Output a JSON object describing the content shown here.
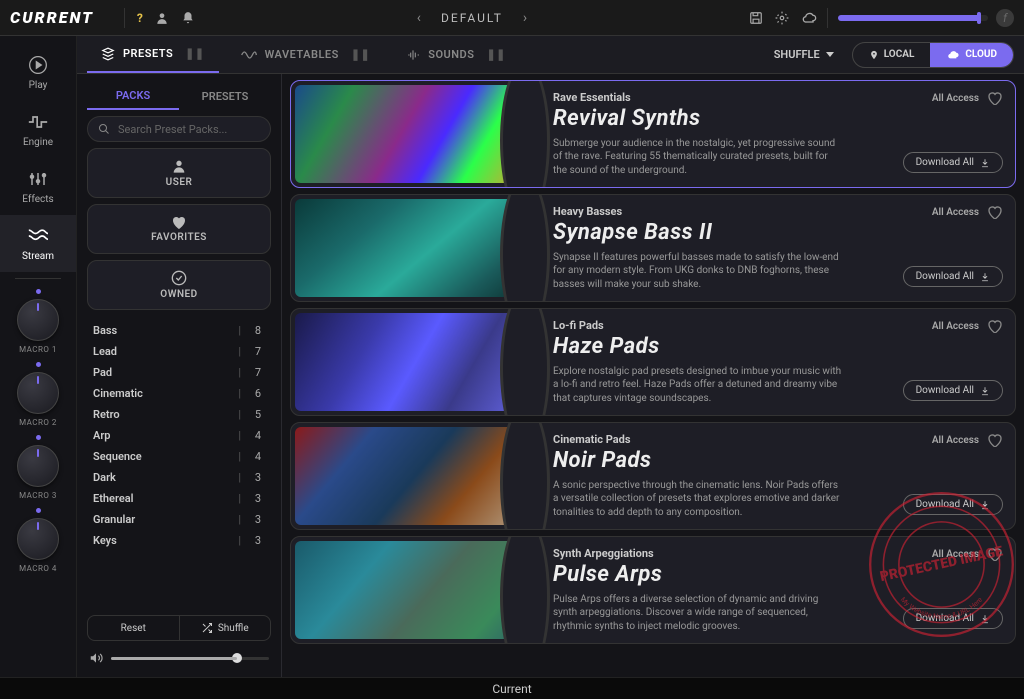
{
  "app": {
    "name": "CURRENT",
    "bottom_label": "Current"
  },
  "topbar": {
    "preset": "DEFAULT",
    "icons": {
      "help": "?",
      "user": "user-icon",
      "bell": "bell-icon",
      "save": "save-icon",
      "gear": "gear-icon",
      "cloud": "cloud-icon"
    }
  },
  "leftnav": {
    "items": [
      {
        "label": "Play",
        "icon": "play-icon"
      },
      {
        "label": "Engine",
        "icon": "wave-icon"
      },
      {
        "label": "Effects",
        "icon": "sliders-icon"
      },
      {
        "label": "Stream",
        "icon": "stream-icon"
      }
    ],
    "macros": [
      "MACRO 1",
      "MACRO 2",
      "MACRO 3",
      "MACRO 4"
    ]
  },
  "tabs": {
    "presets": "PRESETS",
    "wavetables": "WAVETABLES",
    "sounds": "SOUNDS",
    "shuffle": "SHUFFLE",
    "local": "LOCAL",
    "cloud": "CLOUD"
  },
  "sidebar": {
    "tabs": {
      "packs": "PACKS",
      "presets": "PRESETS"
    },
    "search_placeholder": "Search Preset Packs...",
    "cards": {
      "user": "USER",
      "favorites": "FAVORITES",
      "owned": "OWNED"
    },
    "categories": [
      {
        "name": "Bass",
        "count": 8
      },
      {
        "name": "Lead",
        "count": 7
      },
      {
        "name": "Pad",
        "count": 7
      },
      {
        "name": "Cinematic",
        "count": 6
      },
      {
        "name": "Retro",
        "count": 5
      },
      {
        "name": "Arp",
        "count": 4
      },
      {
        "name": "Sequence",
        "count": 4
      },
      {
        "name": "Dark",
        "count": 3
      },
      {
        "name": "Ethereal",
        "count": 3
      },
      {
        "name": "Granular",
        "count": 3
      },
      {
        "name": "Keys",
        "count": 3
      }
    ],
    "reset": "Reset",
    "shuffle": "Shuffle"
  },
  "packs": {
    "access_label": "All Access",
    "download_label": "Download All",
    "items": [
      {
        "category": "Rave Essentials",
        "title": "Revival Synths",
        "desc": "Submerge your audience in the nostalgic, yet progressive sound of the rave. Featuring 55 thematically curated presets, built for the sound of the underground."
      },
      {
        "category": "Heavy Basses",
        "title": "Synapse Bass II",
        "desc": "Synapse II features powerful basses made to satisfy the low-end for any modern style. From UKG donks to DNB foghorns, these basses will make your sub shake."
      },
      {
        "category": "Lo-fi Pads",
        "title": "Haze Pads",
        "desc": "Explore nostalgic pad presets designed to imbue your music with a lo-fi and retro feel. Haze Pads offer a detuned and dreamy vibe that captures vintage soundscapes."
      },
      {
        "category": "Cinematic Pads",
        "title": "Noir Pads",
        "desc": "A sonic perspective through the cinematic lens. Noir Pads offers a versatile collection of presets that explores emotive and darker tonalities to add depth to any composition."
      },
      {
        "category": "Synth Arpeggiations",
        "title": "Pulse Arps",
        "desc": "Pulse Arps offers a diverse selection of dynamic and driving synth arpeggiations. Discover a wide range of sequenced, rhythmic synths to inject melodic grooves."
      }
    ]
  },
  "stamp": {
    "main": "PROTECTED IMAGE",
    "sub": "My Website Name & URL Here"
  }
}
